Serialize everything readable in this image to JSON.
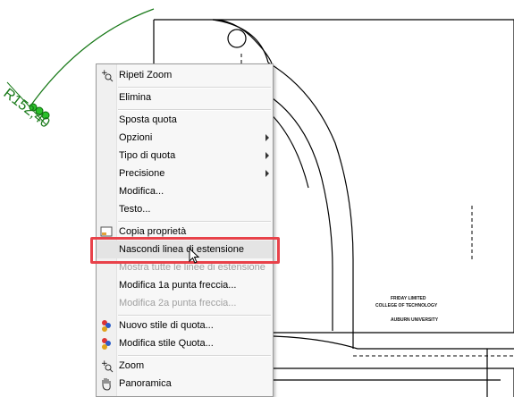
{
  "drawing": {
    "dimension_label": "R152,40",
    "title_block": {
      "line1": "FRIDAY LIMITED",
      "line2": "COLLEGE OF TECHNOLOGY",
      "line3": "AUBURN UNIVERSITY"
    }
  },
  "context_menu": {
    "items": [
      {
        "label": "Ripeti Zoom",
        "icon": "zoom-repeat-icon",
        "enabled": true,
        "submenu": false
      },
      {
        "label": "Elimina",
        "enabled": true,
        "submenu": false
      },
      {
        "label": "Sposta quota",
        "enabled": true,
        "submenu": false
      },
      {
        "label": "Opzioni",
        "enabled": true,
        "submenu": true
      },
      {
        "label": "Tipo di quota",
        "enabled": true,
        "submenu": true
      },
      {
        "label": "Precisione",
        "enabled": true,
        "submenu": true
      },
      {
        "label": "Modifica...",
        "enabled": true,
        "submenu": false
      },
      {
        "label": "Testo...",
        "enabled": true,
        "submenu": false
      },
      {
        "label": "Copia proprietà",
        "icon": "copy-properties-icon",
        "enabled": true,
        "submenu": false
      },
      {
        "label": "Nascondi linea di estensione",
        "enabled": true,
        "submenu": false,
        "highlighted": true
      },
      {
        "label": "Mostra tutte le linee di estensione",
        "enabled": false,
        "submenu": false
      },
      {
        "label": "Modifica 1a punta freccia...",
        "enabled": true,
        "submenu": false
      },
      {
        "label": "Modifica 2a punta freccia...",
        "enabled": false,
        "submenu": false
      },
      {
        "label": "Nuovo stile di quota...",
        "icon": "new-style-icon",
        "enabled": true,
        "submenu": false
      },
      {
        "label": "Modifica stile Quota...",
        "icon": "edit-style-icon",
        "enabled": true,
        "submenu": false
      },
      {
        "label": "Zoom",
        "icon": "zoom-icon",
        "enabled": true,
        "submenu": false
      },
      {
        "label": "Panoramica",
        "icon": "pan-hand-icon",
        "enabled": true,
        "submenu": false
      }
    ]
  },
  "colors": {
    "highlight_box": "#e8424a",
    "dimension_green": "#1a7a1a"
  }
}
